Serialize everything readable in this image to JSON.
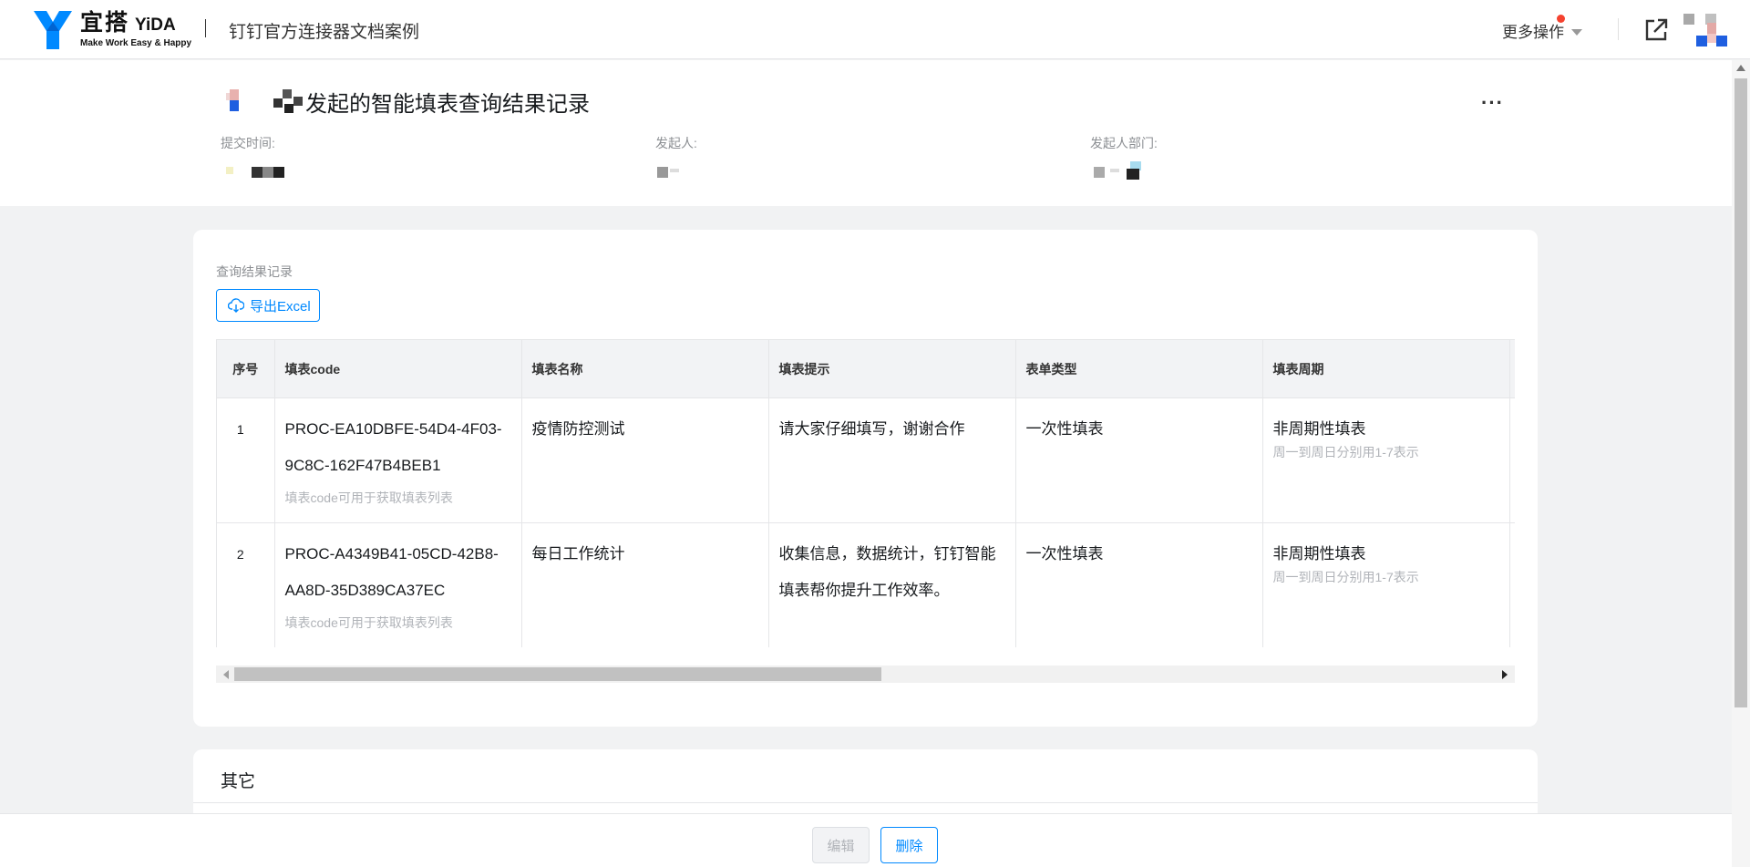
{
  "header": {
    "logo_cn": "宜搭",
    "logo_brand": "YiDA",
    "logo_tagline": "Make Work Easy & Happy",
    "app_title": "钉钉官方连接器文档案例",
    "more_ops": "更多操作",
    "colors": {
      "brand": "#0089ff",
      "notify_dot": "#f5422f"
    }
  },
  "info": {
    "title": "发起的智能填表查询结果记录",
    "fields": [
      {
        "label": "提交时间:"
      },
      {
        "label": "发起人:"
      },
      {
        "label": "发起人部门:"
      }
    ]
  },
  "record_section": {
    "label": "查询结果记录",
    "export_label": "导出Excel",
    "columns": [
      "序号",
      "填表code",
      "填表名称",
      "填表提示",
      "表单类型",
      "填表周期"
    ],
    "rows": [
      {
        "index": "1",
        "code": "PROC-EA10DBFE-54D4-4F03-9C8C-162F47B4BEB1",
        "code_hint": "填表code可用于获取填表列表",
        "name": "疫情防控测试",
        "tip": "请大家仔细填写，谢谢合作",
        "type": "一次性填表",
        "cycle": "非周期性填表",
        "cycle_hint": "周一到周日分别用1-7表示"
      },
      {
        "index": "2",
        "code": "PROC-A4349B41-05CD-42B8-AA8D-35D389CA37EC",
        "code_hint": "填表code可用于获取填表列表",
        "name": "每日工作统计",
        "tip": "收集信息，数据统计，钉钉智能填表帮你提升工作效率。",
        "type": "一次性填表",
        "cycle": "非周期性填表",
        "cycle_hint": "周一到周日分别用1-7表示"
      }
    ]
  },
  "other_section": {
    "title": "其它"
  },
  "footer": {
    "edit_label": "编辑",
    "delete_label": "删除"
  }
}
